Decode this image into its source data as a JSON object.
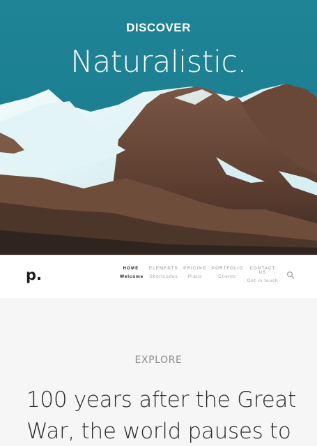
{
  "hero": {
    "kicker": "DISCOVER",
    "title": "Naturalistic."
  },
  "navbar": {
    "logo": "p.",
    "items": [
      {
        "label": "HOME",
        "sub": "Welcome",
        "active": true
      },
      {
        "label": "ELEMENTS",
        "sub": "Shortcodes",
        "active": false
      },
      {
        "label": "PRICING",
        "sub": "Plans",
        "active": false
      },
      {
        "label": "PORTFOLIO",
        "sub": "Clients",
        "active": false
      },
      {
        "label": "CONTACT US",
        "sub": "Get in touch",
        "active": false
      }
    ],
    "search_icon": "search-icon"
  },
  "section": {
    "kicker": "EXPLORE",
    "headline": "100 years after the Great War, the world pauses to"
  },
  "colors": {
    "sky": "#1c7f92",
    "snow": "#d9f0f3",
    "rock": "#6b4a3a",
    "page_bg": "#f6f6f6",
    "nav_bg": "#ffffff"
  }
}
